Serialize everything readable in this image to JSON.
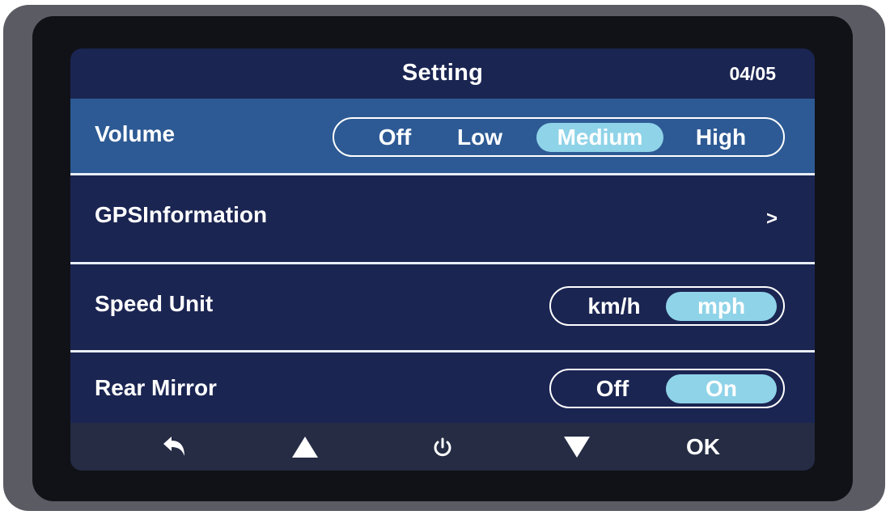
{
  "header": {
    "title": "Setting",
    "page": "04/05"
  },
  "rows": [
    {
      "label": "Volume",
      "options": [
        "Off",
        "Low",
        "Medium",
        "High"
      ],
      "selected": "Medium",
      "highlighted": true
    },
    {
      "label": "GPSInformation",
      "chevron": ">"
    },
    {
      "label": "Speed Unit",
      "options": [
        "km/h",
        "mph"
      ],
      "selected": "mph"
    },
    {
      "label": "Rear Mirror",
      "options": [
        "Off",
        "On"
      ],
      "selected": "On"
    }
  ],
  "navbar": {
    "icons": [
      "back-icon",
      "up-arrow-icon",
      "power-icon",
      "down-arrow-icon"
    ],
    "ok_label": "OK"
  },
  "colors": {
    "screen_bg": "#1b2552",
    "highlight_row": "#2d5a94",
    "active_option": "#8fd3e8",
    "navbar_bg": "#252c44"
  }
}
